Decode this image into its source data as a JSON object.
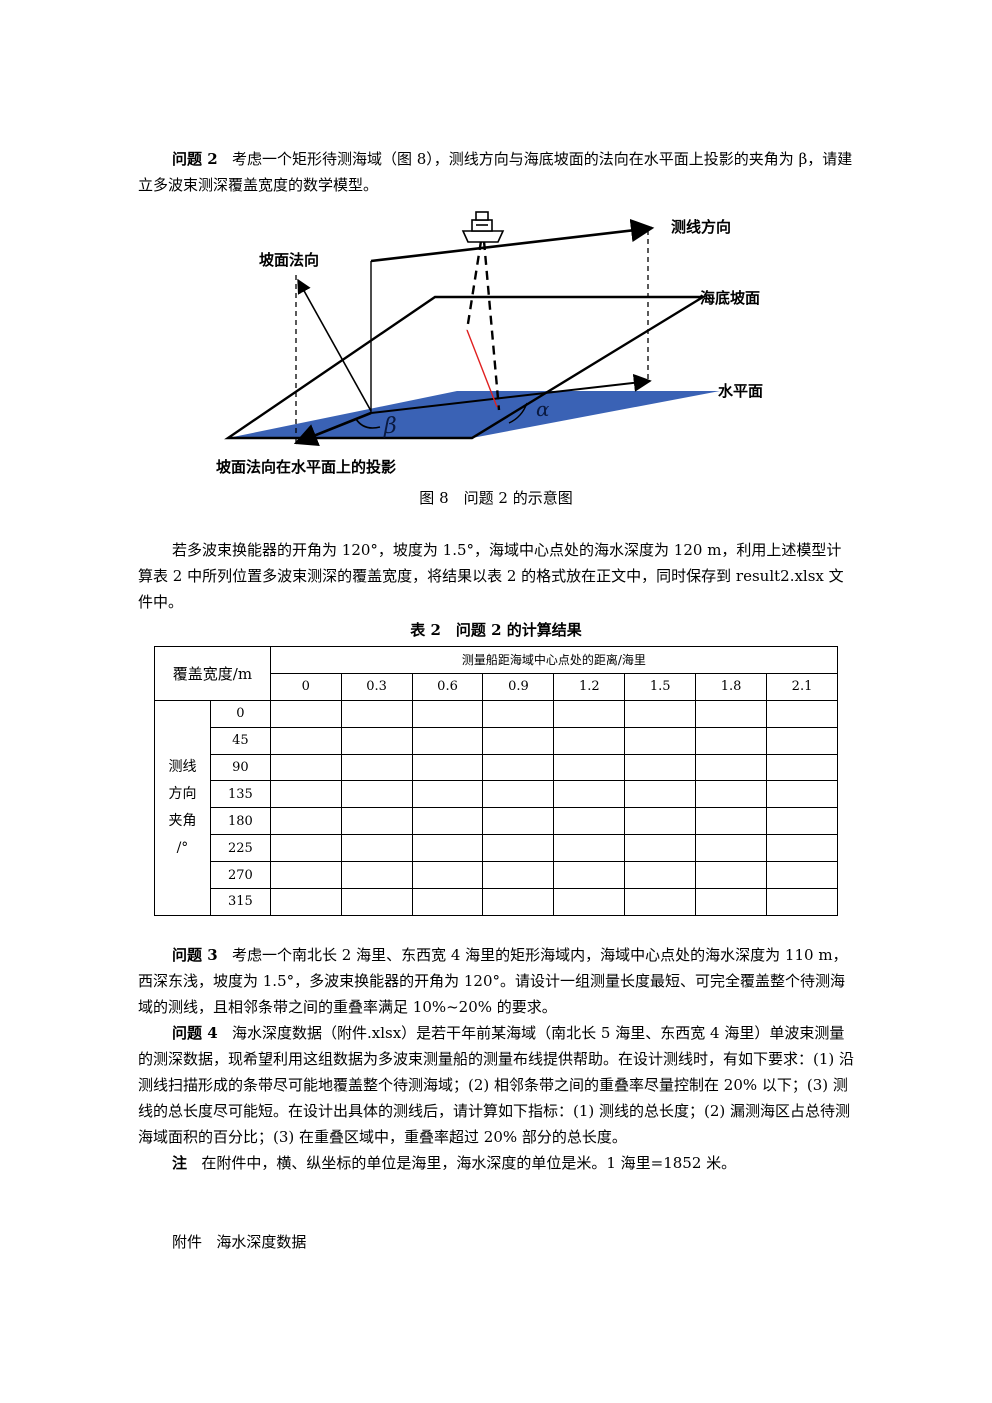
{
  "q2": {
    "label": "问题 2",
    "text": "考虑一个矩形待测海域（图 8），测线方向与海底坡面的法向在水平面上投影的夹角为 β，请建立多波束测深覆盖宽度的数学模型。"
  },
  "figure": {
    "labels": {
      "survey_dir": "测线方向",
      "slope_normal": "坡面法向",
      "seabed_slope": "海底坡面",
      "horizontal_plane": "水平面",
      "normal_projection": "坡面法向在水平面上的投影",
      "alpha": "α",
      "beta": "β"
    },
    "caption": "图 8　问题 2 的示意图",
    "colors": {
      "plane": "#3a62b5",
      "beam": "#e02020"
    }
  },
  "intro": {
    "text": "若多波束换能器的开角为 120°，坡度为 1.5°，海域中心点处的海水深度为 120 m，利用上述模型计算表 2 中所列位置多波束测深的覆盖宽度，将结果以表 2 的格式放在正文中，同时保存到 result2.xlsx 文件中。"
  },
  "table": {
    "caption": "表 2　问题 2 的计算结果",
    "corner": "覆盖宽度/m",
    "col_header": "测量船距海域中心点处的距离/海里",
    "distances": [
      "0",
      "0.3",
      "0.6",
      "0.9",
      "1.2",
      "1.5",
      "1.8",
      "2.1"
    ],
    "row_header": [
      "测线",
      "方向",
      "夹角",
      "/°"
    ],
    "angles": [
      "0",
      "45",
      "90",
      "135",
      "180",
      "225",
      "270",
      "315"
    ]
  },
  "q3": {
    "label": "问题 3",
    "text": "考虑一个南北长 2 海里、东西宽 4 海里的矩形海域内，海域中心点处的海水深度为 110 m，西深东浅，坡度为 1.5°，多波束换能器的开角为 120°。请设计一组测量长度最短、可完全覆盖整个待测海域的测线，且相邻条带之间的重叠率满足 10%~20% 的要求。"
  },
  "q4": {
    "label": "问题 4",
    "text": "海水深度数据（附件.xlsx）是若干年前某海域（南北长 5 海里、东西宽 4 海里）单波束测量的测深数据，现希望利用这组数据为多波束测量船的测量布线提供帮助。在设计测线时，有如下要求：(1) 沿测线扫描形成的条带尽可能地覆盖整个待测海域；(2) 相邻条带之间的重叠率尽量控制在 20% 以下；(3) 测线的总长度尽可能短。在设计出具体的测线后，请计算如下指标：(1) 测线的总长度；(2) 漏测海区占总待测海域面积的百分比；(3) 在重叠区域中，重叠率超过 20% 部分的总长度。"
  },
  "note": {
    "label": "注",
    "text": "在附件中，横、纵坐标的单位是海里，海水深度的单位是米。1 海里=1852 米。"
  },
  "attachment": {
    "label": "附件",
    "text": "海水深度数据"
  }
}
